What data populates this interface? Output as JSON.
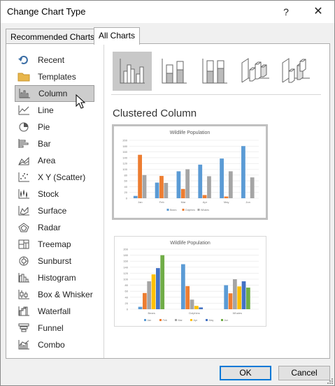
{
  "window": {
    "title": "Change Chart Type",
    "help": "?",
    "close": "✕"
  },
  "tabs": [
    {
      "label": "Recommended Charts"
    },
    {
      "label": "All Charts"
    }
  ],
  "sidebar": {
    "items": [
      {
        "label": "Recent",
        "icon": "recent-icon"
      },
      {
        "label": "Templates",
        "icon": "folder-icon"
      },
      {
        "label": "Column",
        "icon": "column-chart-icon",
        "selected": true
      },
      {
        "label": "Line",
        "icon": "line-chart-icon"
      },
      {
        "label": "Pie",
        "icon": "pie-chart-icon"
      },
      {
        "label": "Bar",
        "icon": "bar-chart-icon"
      },
      {
        "label": "Area",
        "icon": "area-chart-icon"
      },
      {
        "label": "X Y (Scatter)",
        "icon": "scatter-chart-icon"
      },
      {
        "label": "Stock",
        "icon": "stock-chart-icon"
      },
      {
        "label": "Surface",
        "icon": "surface-chart-icon"
      },
      {
        "label": "Radar",
        "icon": "radar-chart-icon"
      },
      {
        "label": "Treemap",
        "icon": "treemap-chart-icon"
      },
      {
        "label": "Sunburst",
        "icon": "sunburst-chart-icon"
      },
      {
        "label": "Histogram",
        "icon": "histogram-chart-icon"
      },
      {
        "label": "Box & Whisker",
        "icon": "box-whisker-chart-icon"
      },
      {
        "label": "Waterfall",
        "icon": "waterfall-chart-icon"
      },
      {
        "label": "Funnel",
        "icon": "funnel-chart-icon"
      },
      {
        "label": "Combo",
        "icon": "combo-chart-icon"
      }
    ]
  },
  "content": {
    "section_title": "Clustered Column",
    "subtypes": [
      {
        "name": "clustered-column-icon",
        "selected": true
      },
      {
        "name": "stacked-column-icon"
      },
      {
        "name": "100-stacked-column-icon"
      },
      {
        "name": "3d-clustered-column-icon"
      },
      {
        "name": "3d-column-icon"
      }
    ]
  },
  "colors": {
    "blue": "#5b9bd5",
    "orange": "#ed7d31",
    "gray": "#a5a5a5",
    "yellow": "#ffc000",
    "lightblue": "#4472c4",
    "green": "#70ad47"
  },
  "chart_data": [
    {
      "type": "bar",
      "title": "Wildlife Population",
      "categories": [
        "Jan",
        "Feb",
        "Mar",
        "Apr",
        "May",
        "Jun"
      ],
      "ylim": [
        0,
        200
      ],
      "yticks": [
        "0",
        "20",
        "40",
        "60",
        "80",
        "100",
        "120",
        "140",
        "160",
        "180",
        "200"
      ],
      "series": [
        {
          "name": "Bears",
          "color": "#5b9bd5",
          "values": [
            8,
            54,
            93,
            116,
            137,
            180
          ]
        },
        {
          "name": "Dolphins",
          "color": "#ed7d31",
          "values": [
            150,
            77,
            32,
            11,
            6,
            0
          ]
        },
        {
          "name": "Whales",
          "color": "#a5a5a5",
          "values": [
            80,
            53,
            100,
            76,
            93,
            72
          ]
        }
      ]
    },
    {
      "type": "bar",
      "title": "Wildlife Population",
      "categories": [
        "Bears",
        "Dolphins",
        "Whales"
      ],
      "ylim": [
        0,
        200
      ],
      "yticks": [
        "0",
        "20",
        "40",
        "60",
        "80",
        "100",
        "120",
        "140",
        "160",
        "180",
        "200"
      ],
      "series": [
        {
          "name": "Jan",
          "color": "#5b9bd5",
          "values": [
            8,
            150,
            80
          ]
        },
        {
          "name": "Feb",
          "color": "#ed7d31",
          "values": [
            54,
            77,
            53
          ]
        },
        {
          "name": "Mar",
          "color": "#a5a5a5",
          "values": [
            93,
            32,
            100
          ]
        },
        {
          "name": "Apr",
          "color": "#ffc000",
          "values": [
            116,
            11,
            76
          ]
        },
        {
          "name": "May",
          "color": "#4472c4",
          "values": [
            137,
            6,
            93
          ]
        },
        {
          "name": "Jun",
          "color": "#70ad47",
          "values": [
            180,
            0,
            72
          ]
        }
      ]
    }
  ],
  "buttons": {
    "ok": "OK",
    "cancel": "Cancel"
  }
}
